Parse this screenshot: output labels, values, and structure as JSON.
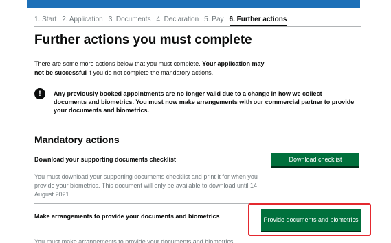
{
  "steps": [
    {
      "label": "1. Start"
    },
    {
      "label": "2. Application"
    },
    {
      "label": "3. Documents"
    },
    {
      "label": "4. Declaration"
    },
    {
      "label": "5. Pay"
    },
    {
      "label": "6. Further actions",
      "current": true
    }
  ],
  "page_title": "Further actions you must complete",
  "intro": {
    "text": "There are some more actions below that you must complete. ",
    "bold": "Your application may not be successful",
    "rest": " if you do not complete the mandatory actions."
  },
  "warning": {
    "icon": "!",
    "text": "Any previously booked appointments are no longer valid due to a change in how we collect documents and biometrics. You must now make arrangements with our commercial partner to provide your documents and biometrics."
  },
  "mandatory_heading": "Mandatory actions",
  "actions": [
    {
      "title": "Download your supporting documents checklist",
      "button": "Download checklist",
      "description": "You must download your supporting documents checklist and print it for when you provide your biometrics. This document will only be available to download until 14 August 2021."
    },
    {
      "title": "Make arrangements to provide your documents and biometrics",
      "button": "Provide documents and biometrics",
      "description": "You must make arrangements to provide your documents and biometrics"
    }
  ],
  "colors": {
    "brand_blue": "#1d70b8",
    "button_green": "#00703c",
    "highlight_red": "#e4292f",
    "text": "#0b0c0c",
    "secondary_text": "#6f777b"
  }
}
